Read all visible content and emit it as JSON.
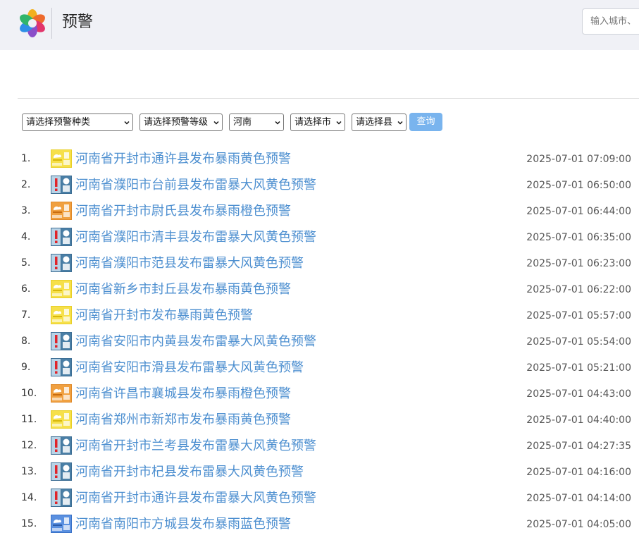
{
  "header": {
    "title": "预警",
    "search_placeholder": "输入城市、"
  },
  "filters": {
    "type": "请选择预警种类",
    "level": "请选择预警等级",
    "province": "河南",
    "city": "请选择市",
    "county": "请选择县",
    "query_label": "查询"
  },
  "colors": {
    "link": "#4d8fd0",
    "query_button": "#79b4ee",
    "header_bg": "#f0f1f6"
  },
  "warnings": [
    {
      "index": "1.",
      "title": "河南省开封市通许县发布暴雨黄色预警",
      "time": "2025-07-01 07:09:00",
      "icon": "rainstorm-yellow-icon"
    },
    {
      "index": "2.",
      "title": "河南省濮阳市台前县发布雷暴大风黄色预警",
      "time": "2025-07-01 06:50:00",
      "icon": "thunderstorm-wind-yellow-icon"
    },
    {
      "index": "3.",
      "title": "河南省开封市尉氏县发布暴雨橙色预警",
      "time": "2025-07-01 06:44:00",
      "icon": "rainstorm-orange-icon"
    },
    {
      "index": "4.",
      "title": "河南省濮阳市清丰县发布雷暴大风黄色预警",
      "time": "2025-07-01 06:35:00",
      "icon": "thunderstorm-wind-yellow-icon"
    },
    {
      "index": "5.",
      "title": "河南省濮阳市范县发布雷暴大风黄色预警",
      "time": "2025-07-01 06:23:00",
      "icon": "thunderstorm-wind-yellow-icon"
    },
    {
      "index": "6.",
      "title": "河南省新乡市封丘县发布暴雨黄色预警",
      "time": "2025-07-01 06:22:00",
      "icon": "rainstorm-yellow-icon"
    },
    {
      "index": "7.",
      "title": "河南省开封市发布暴雨黄色预警",
      "time": "2025-07-01 05:57:00",
      "icon": "rainstorm-yellow-icon"
    },
    {
      "index": "8.",
      "title": "河南省安阳市内黄县发布雷暴大风黄色预警",
      "time": "2025-07-01 05:54:00",
      "icon": "thunderstorm-wind-yellow-icon"
    },
    {
      "index": "9.",
      "title": "河南省安阳市滑县发布雷暴大风黄色预警",
      "time": "2025-07-01 05:21:00",
      "icon": "thunderstorm-wind-yellow-icon"
    },
    {
      "index": "10.",
      "title": "河南省许昌市襄城县发布暴雨橙色预警",
      "time": "2025-07-01 04:43:00",
      "icon": "rainstorm-orange-icon"
    },
    {
      "index": "11.",
      "title": "河南省郑州市新郑市发布暴雨黄色预警",
      "time": "2025-07-01 04:40:00",
      "icon": "rainstorm-yellow-icon"
    },
    {
      "index": "12.",
      "title": "河南省开封市兰考县发布雷暴大风黄色预警",
      "time": "2025-07-01 04:27:35",
      "icon": "thunderstorm-wind-yellow-icon"
    },
    {
      "index": "13.",
      "title": "河南省开封市杞县发布雷暴大风黄色预警",
      "time": "2025-07-01 04:16:00",
      "icon": "thunderstorm-wind-yellow-icon"
    },
    {
      "index": "14.",
      "title": "河南省开封市通许县发布雷暴大风黄色预警",
      "time": "2025-07-01 04:14:00",
      "icon": "thunderstorm-wind-yellow-icon"
    },
    {
      "index": "15.",
      "title": "河南省南阳市方城县发布暴雨蓝色预警",
      "time": "2025-07-01 04:05:00",
      "icon": "rainstorm-blue-icon"
    }
  ]
}
